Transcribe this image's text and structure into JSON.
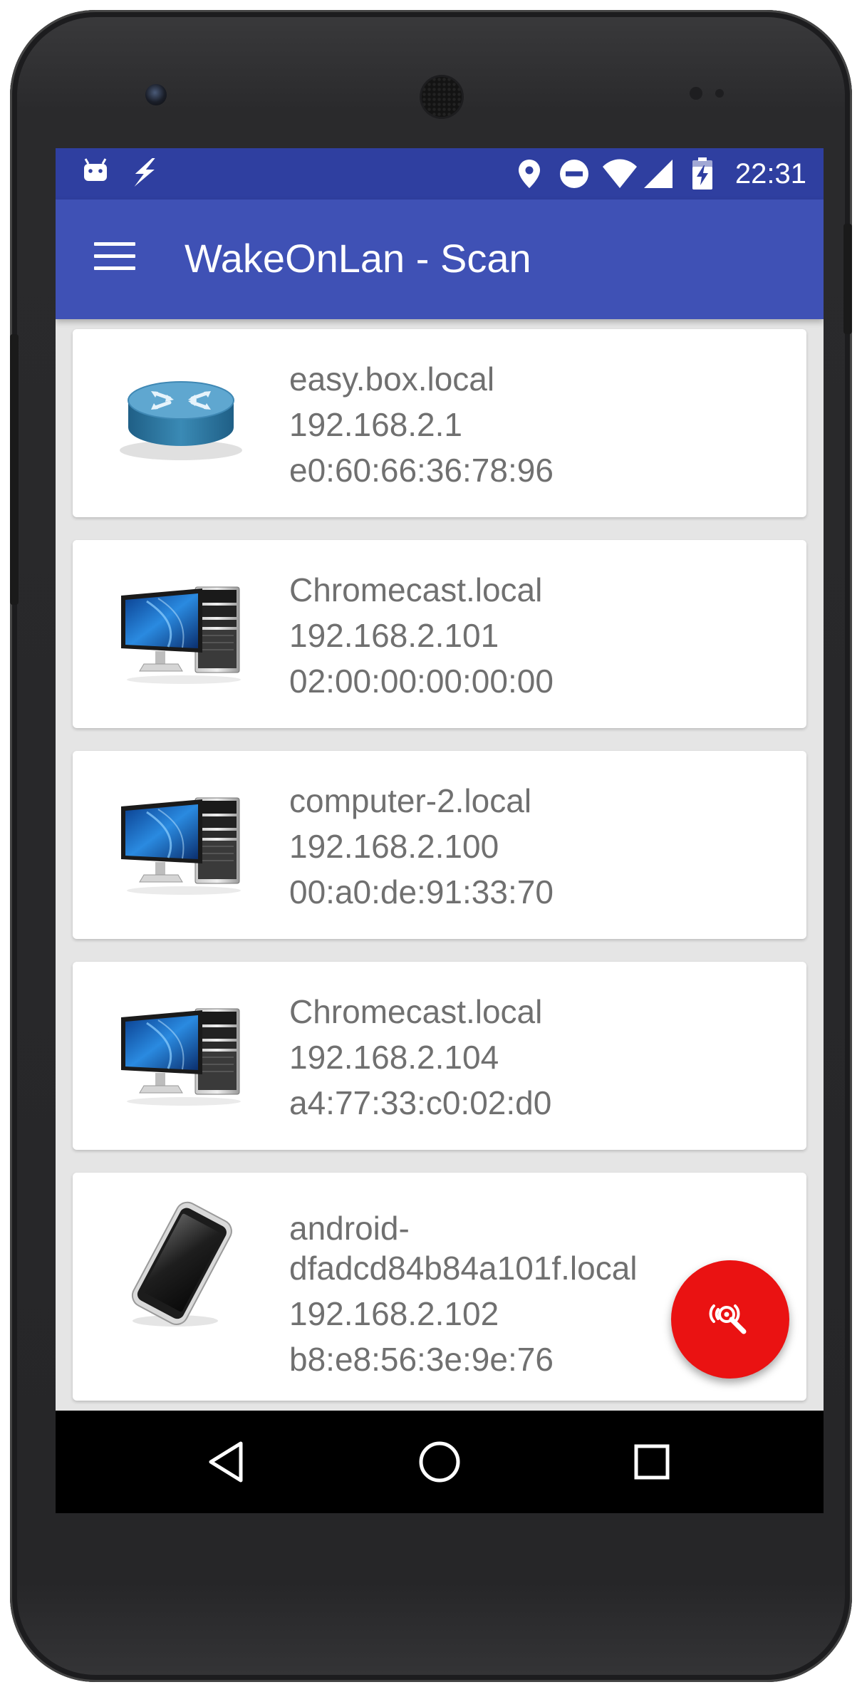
{
  "status_bar": {
    "time": "22:31",
    "left_icons": [
      "android-icon",
      "flash-icon"
    ],
    "right_icons": [
      "location-icon",
      "do-not-disturb-icon",
      "wifi-icon",
      "cell-signal-icon",
      "battery-charging-icon"
    ],
    "color": "#2f3fa0"
  },
  "app_bar": {
    "title": "WakeOnLan - Scan",
    "menu_icon": "menu-icon",
    "color": "#3f51b5"
  },
  "devices": [
    {
      "type": "router",
      "name": "easy.box.local",
      "ip": "192.168.2.1",
      "mac": "e0:60:66:36:78:96"
    },
    {
      "type": "computer",
      "name": "Chromecast.local",
      "ip": "192.168.2.101",
      "mac": "02:00:00:00:00:00"
    },
    {
      "type": "computer",
      "name": "computer-2.local",
      "ip": "192.168.2.100",
      "mac": "00:a0:de:91:33:70"
    },
    {
      "type": "computer",
      "name": "Chromecast.local",
      "ip": "192.168.2.104",
      "mac": "a4:77:33:c0:02:d0"
    },
    {
      "type": "phone",
      "name_line1": "android-",
      "name_line2": "dfadcd84b84a101f.local",
      "ip": "192.168.2.102",
      "mac": "b8:e8:56:3e:9e:76"
    }
  ],
  "fab": {
    "icon": "scan-network-icon",
    "color": "#ea1212"
  },
  "nav_bar": {
    "buttons": [
      "back-icon",
      "home-icon",
      "recents-icon"
    ]
  }
}
